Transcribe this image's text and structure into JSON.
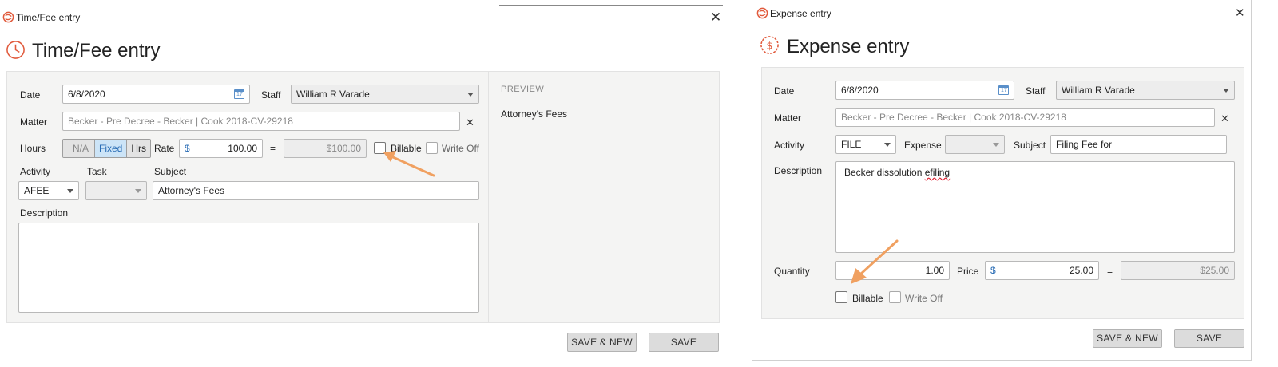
{
  "colors": {
    "brand": "#e15a3c",
    "arrow": "#f0a060",
    "accent": "#2a6db5"
  },
  "time_fee": {
    "window_title": "Time/Fee entry",
    "heading": "Time/Fee entry",
    "icon": "clock-icon",
    "date_label": "Date",
    "date_value": "6/8/2020",
    "staff_label": "Staff",
    "staff_value": "William R Varade",
    "matter_label": "Matter",
    "matter_value": "Becker - Pre Decree - Becker | Cook 2018-CV-29218",
    "hours_label": "Hours",
    "hours_modes": [
      "N/A",
      "Fixed",
      "Hrs"
    ],
    "rate_label": "Rate",
    "currency": "$",
    "rate_value": "100.00",
    "equals": "=",
    "total_value": "$100.00",
    "billable_label": "Billable",
    "writeoff_label": "Write Off",
    "activity_label": "Activity",
    "activity_value": "AFEE",
    "task_label": "Task",
    "task_value": "",
    "subject_label": "Subject",
    "subject_value": "Attorney's Fees",
    "description_label": "Description",
    "description_value": "",
    "preview_label": "PREVIEW",
    "preview_text": "Attorney's Fees",
    "save_new_label": "SAVE & NEW",
    "save_label": "SAVE"
  },
  "expense": {
    "window_title": "Expense entry",
    "heading": "Expense entry",
    "icon": "dollar-circle-icon",
    "date_label": "Date",
    "date_value": "6/8/2020",
    "staff_label": "Staff",
    "staff_value": "William R Varade",
    "matter_label": "Matter",
    "matter_value": "Becker - Pre Decree - Becker | Cook 2018-CV-29218",
    "activity_label": "Activity",
    "activity_value": "FILE",
    "expense_label": "Expense",
    "expense_value": "",
    "subject_label": "Subject",
    "subject_value": "Filing Fee for",
    "description_label": "Description",
    "description_word1": "Becker dissolution",
    "description_word2": "efiling",
    "quantity_label": "Quantity",
    "quantity_value": "1.00",
    "price_label": "Price",
    "currency": "$",
    "price_value": "25.00",
    "equals": "=",
    "total_value": "$25.00",
    "billable_label": "Billable",
    "writeoff_label": "Write Off",
    "save_new_label": "SAVE & NEW",
    "save_label": "SAVE"
  }
}
